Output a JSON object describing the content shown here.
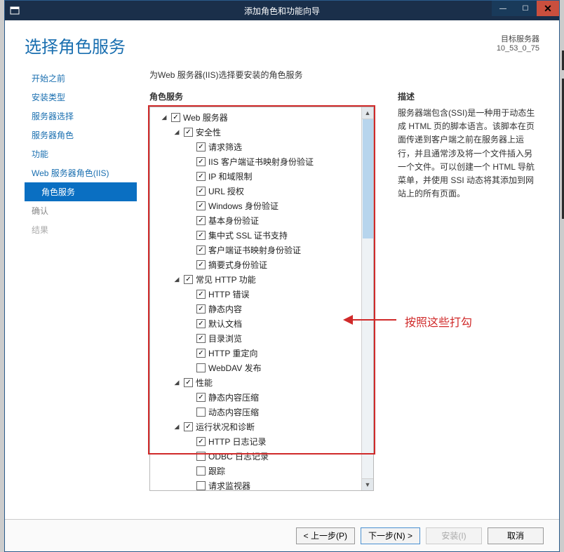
{
  "titlebar": {
    "title": "添加角色和功能向导"
  },
  "header": {
    "pageTitle": "选择角色服务",
    "targetLabel": "目标服务器",
    "targetValue": "10_53_0_75"
  },
  "sidebar": {
    "items": [
      {
        "label": "开始之前",
        "sub": false,
        "selected": false,
        "dim": false
      },
      {
        "label": "安装类型",
        "sub": false,
        "selected": false,
        "dim": false
      },
      {
        "label": "服务器选择",
        "sub": false,
        "selected": false,
        "dim": false
      },
      {
        "label": "服务器角色",
        "sub": false,
        "selected": false,
        "dim": false
      },
      {
        "label": "功能",
        "sub": false,
        "selected": false,
        "dim": false
      },
      {
        "label": "Web 服务器角色(IIS)",
        "sub": false,
        "selected": false,
        "dim": false
      },
      {
        "label": "角色服务",
        "sub": true,
        "selected": true,
        "dim": false
      },
      {
        "label": "确认",
        "sub": false,
        "selected": false,
        "dim": true
      },
      {
        "label": "结果",
        "sub": false,
        "selected": false,
        "dim": true
      }
    ]
  },
  "main": {
    "subtitle": "为Web 服务器(IIS)选择要安装的角色服务",
    "roleServicesHeading": "角色服务",
    "descHeading": "描述",
    "descText": "服务器端包含(SSI)是一种用于动态生成 HTML 页的脚本语言。该脚本在页面传递到客户端之前在服务器上运行，并且通常涉及将一个文件插入另一个文件。可以创建一个 HTML 导航菜单，并使用 SSI 动态将其添加到网站上的所有页面。"
  },
  "tree": [
    {
      "indent": 1,
      "exp": "▣",
      "checked": true,
      "label": "Web 服务器"
    },
    {
      "indent": 2,
      "exp": "▣",
      "checked": true,
      "label": "安全性"
    },
    {
      "indent": 3,
      "exp": "",
      "checked": true,
      "label": "请求筛选"
    },
    {
      "indent": 3,
      "exp": "",
      "checked": true,
      "label": "IIS 客户端证书映射身份验证"
    },
    {
      "indent": 3,
      "exp": "",
      "checked": true,
      "label": "IP 和域限制"
    },
    {
      "indent": 3,
      "exp": "",
      "checked": true,
      "label": "URL 授权"
    },
    {
      "indent": 3,
      "exp": "",
      "checked": true,
      "label": "Windows 身份验证"
    },
    {
      "indent": 3,
      "exp": "",
      "checked": true,
      "label": "基本身份验证"
    },
    {
      "indent": 3,
      "exp": "",
      "checked": true,
      "label": "集中式 SSL 证书支持"
    },
    {
      "indent": 3,
      "exp": "",
      "checked": true,
      "label": "客户端证书映射身份验证"
    },
    {
      "indent": 3,
      "exp": "",
      "checked": true,
      "label": "摘要式身份验证"
    },
    {
      "indent": 2,
      "exp": "▣",
      "checked": true,
      "label": "常见 HTTP 功能"
    },
    {
      "indent": 3,
      "exp": "",
      "checked": true,
      "label": "HTTP 错误"
    },
    {
      "indent": 3,
      "exp": "",
      "checked": true,
      "label": "静态内容"
    },
    {
      "indent": 3,
      "exp": "",
      "checked": true,
      "label": "默认文档"
    },
    {
      "indent": 3,
      "exp": "",
      "checked": true,
      "label": "目录浏览"
    },
    {
      "indent": 3,
      "exp": "",
      "checked": true,
      "label": "HTTP 重定向"
    },
    {
      "indent": 3,
      "exp": "",
      "checked": false,
      "label": "WebDAV 发布"
    },
    {
      "indent": 2,
      "exp": "▣",
      "checked": true,
      "label": "性能"
    },
    {
      "indent": 3,
      "exp": "",
      "checked": true,
      "label": "静态内容压缩"
    },
    {
      "indent": 3,
      "exp": "",
      "checked": false,
      "label": "动态内容压缩"
    },
    {
      "indent": 2,
      "exp": "▣",
      "checked": true,
      "label": "运行状况和诊断"
    },
    {
      "indent": 3,
      "exp": "",
      "checked": true,
      "label": "HTTP 日志记录"
    },
    {
      "indent": 3,
      "exp": "",
      "checked": false,
      "label": "ODBC 日志记录"
    },
    {
      "indent": 3,
      "exp": "",
      "checked": false,
      "label": "跟踪"
    },
    {
      "indent": 3,
      "exp": "",
      "checked": false,
      "label": "请求监视器"
    }
  ],
  "footer": {
    "prev": "< 上一步(P)",
    "next": "下一步(N) >",
    "install": "安装(I)",
    "cancel": "取消"
  },
  "annotation": {
    "text": "按照这些打勾"
  }
}
